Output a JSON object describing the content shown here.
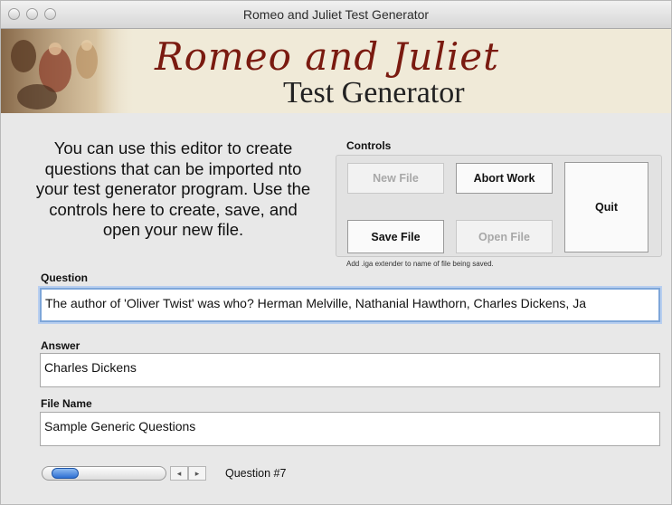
{
  "window": {
    "title": "Romeo and Juliet Test Generator"
  },
  "banner": {
    "title_line1": "Romeo and Juliet",
    "title_line2": "Test Generator"
  },
  "intro": {
    "text": "You can use this editor to create questions that can be imported nto your test generator program. Use the controls here to create, save, and open your new file."
  },
  "controls": {
    "label": "Controls",
    "new_file": "New File",
    "abort_work": "Abort Work",
    "quit": "Quit",
    "save_file": "Save File",
    "open_file": "Open File",
    "hint": "Add .iga extender to name of file being saved."
  },
  "question": {
    "label": "Question",
    "value": "The author of 'Oliver Twist' was who? Herman Melville, Nathanial Hawthorn, Charles Dickens, Ja"
  },
  "answer": {
    "label": "Answer",
    "value": "Charles Dickens"
  },
  "file_name": {
    "label": "File Name",
    "value": "Sample Generic Questions"
  },
  "navigator": {
    "left_arrow": "◂",
    "right_arrow": "▸",
    "question_counter": "Question #7"
  },
  "colors": {
    "banner_title": "#7a1a10",
    "focus_ring": "#7ea6d9",
    "scroll_thumb": "#2d6fd2"
  }
}
